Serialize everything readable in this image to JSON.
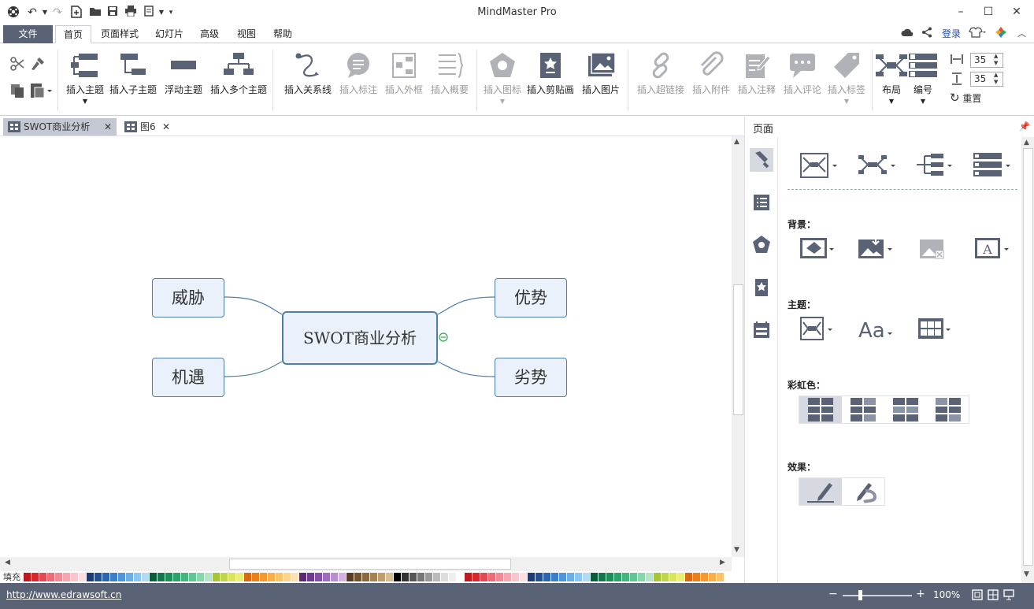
{
  "app": {
    "title": "MindMaster Pro"
  },
  "menu": {
    "tabs": [
      "文件",
      "首页",
      "页面样式",
      "幻灯片",
      "高级",
      "视图",
      "帮助"
    ],
    "login": "登录"
  },
  "ribbon": {
    "insert_topic": "插入主题",
    "insert_subtopic": "插入子主题",
    "floating_topic": "浮动主题",
    "insert_multiple": "插入多个主题",
    "insert_relation": "插入关系线",
    "insert_callout": "插入标注",
    "insert_boundary": "插入外框",
    "insert_summary": "插入概要",
    "insert_icon": "插入图标",
    "insert_clipart": "插入剪贴画",
    "insert_image": "插入图片",
    "insert_hyperlink": "插入超链接",
    "insert_attachment": "插入附件",
    "insert_note": "插入注释",
    "insert_comment": "插入评论",
    "insert_tag": "插入标签",
    "layout": "布局",
    "numbering": "编号",
    "spacing_h": "35",
    "spacing_v": "35",
    "reset": "重置"
  },
  "doc_tabs": [
    {
      "label": "SWOT商业分析"
    },
    {
      "label": "图6"
    }
  ],
  "mindmap": {
    "central": "SWOT商业分析",
    "topics": {
      "threat": "威胁",
      "opportunity": "机遇",
      "strength": "优势",
      "weakness": "劣势"
    }
  },
  "palette": {
    "label": "填充"
  },
  "panel": {
    "title": "页面",
    "sections": {
      "background": "背景：",
      "theme": "主题：",
      "rainbow": "彩虹色：",
      "effect": "效果："
    }
  },
  "status": {
    "link": "http://www.edrawsoft.cn",
    "zoom": "100%"
  },
  "colors": {
    "accent": "#5a6275",
    "topic_border": "#4f7ea8",
    "topic_fill": "#eaf1fa"
  }
}
